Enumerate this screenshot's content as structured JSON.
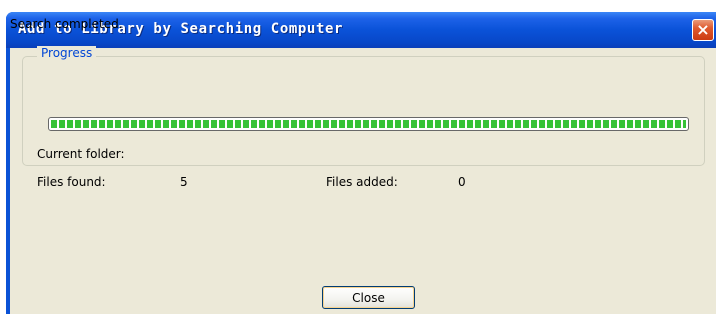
{
  "window": {
    "title": "Add to Library by Searching Computer",
    "close_glyph": "×"
  },
  "status_text": "Search completed.",
  "progress": {
    "group_label": "Progress",
    "percent": 100,
    "bar_color": "#37c237"
  },
  "details": {
    "current_folder_label": "Current folder:",
    "current_folder_value": "",
    "files_found_label": "Files found:",
    "files_found_value": "5",
    "files_added_label": "Files added:",
    "files_added_value": "0"
  },
  "buttons": {
    "close_label": "Close"
  },
  "colors": {
    "titlebar": "#0a52d8",
    "client_bg": "#ece9d8",
    "group_label": "#0046d5"
  }
}
